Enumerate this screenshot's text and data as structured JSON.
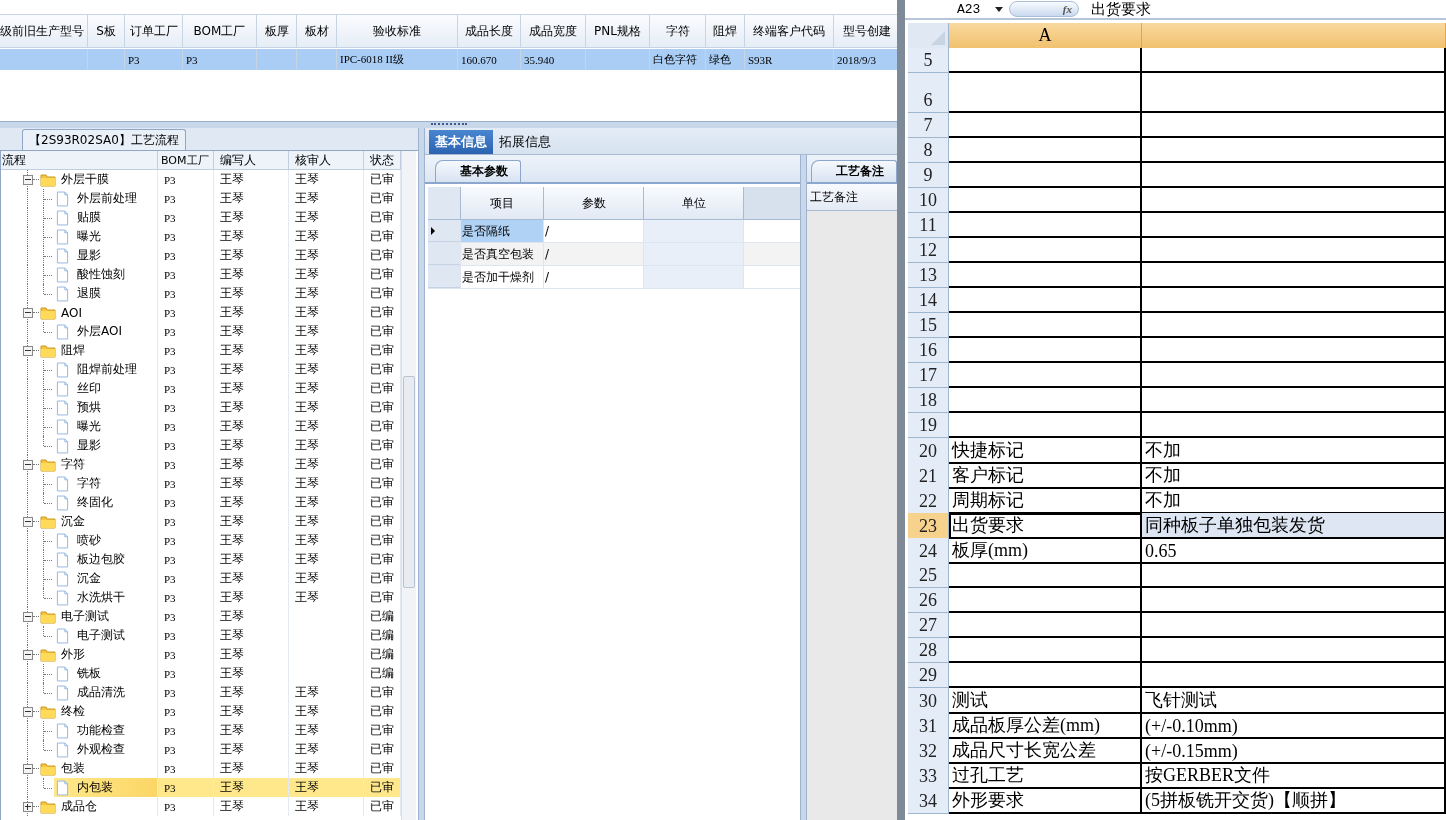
{
  "top_grid": {
    "row_selected": true,
    "columns": [
      {
        "label": "级前旧生产型号"
      },
      {
        "label": "S板"
      },
      {
        "label": "订单工厂",
        "value": "P3"
      },
      {
        "label": "BOM工厂",
        "value": "P3"
      },
      {
        "label": "板厚"
      },
      {
        "label": "板材"
      },
      {
        "label": "验收标准",
        "value": "IPC-6018 II级"
      },
      {
        "label": "成品长度",
        "value": "160.670"
      },
      {
        "label": "成品宽度",
        "value": "35.940"
      },
      {
        "label": "PNL规格"
      },
      {
        "label": "字符",
        "value": "白色字符"
      },
      {
        "label": "阻焊",
        "value": "绿色"
      },
      {
        "label": "终端客户代码",
        "value": "S93R"
      },
      {
        "label": "型号创建",
        "value": "2018/9/3"
      }
    ]
  },
  "process_panel": {
    "title": "【2S93R02SA0】工艺流程",
    "columns": [
      "流程",
      "BOM工厂",
      "编写人",
      "核审人",
      "状态"
    ],
    "tree": [
      {
        "name": "外层干膜",
        "bom": "P3",
        "writer": "王琴",
        "reviewer": "王琴",
        "status": "已审",
        "expanded": true,
        "selected": false,
        "children": [
          {
            "name": "外层前处理",
            "bom": "P3",
            "writer": "王琴",
            "reviewer": "王琴",
            "status": "已审",
            "selected": false
          },
          {
            "name": "贴膜",
            "bom": "P3",
            "writer": "王琴",
            "reviewer": "王琴",
            "status": "已审",
            "selected": false
          },
          {
            "name": "曝光",
            "bom": "P3",
            "writer": "王琴",
            "reviewer": "王琴",
            "status": "已审",
            "selected": false
          },
          {
            "name": "显影",
            "bom": "P3",
            "writer": "王琴",
            "reviewer": "王琴",
            "status": "已审",
            "selected": false
          },
          {
            "name": "酸性蚀刻",
            "bom": "P3",
            "writer": "王琴",
            "reviewer": "王琴",
            "status": "已审",
            "selected": false
          },
          {
            "name": "退膜",
            "bom": "P3",
            "writer": "王琴",
            "reviewer": "王琴",
            "status": "已审",
            "selected": false
          }
        ]
      },
      {
        "name": "AOI",
        "bom": "P3",
        "writer": "王琴",
        "reviewer": "王琴",
        "status": "已审",
        "expanded": true,
        "selected": false,
        "children": [
          {
            "name": "外层AOI",
            "bom": "P3",
            "writer": "王琴",
            "reviewer": "王琴",
            "status": "已审",
            "selected": false
          }
        ]
      },
      {
        "name": "阻焊",
        "bom": "P3",
        "writer": "王琴",
        "reviewer": "王琴",
        "status": "已审",
        "expanded": true,
        "selected": false,
        "children": [
          {
            "name": "阻焊前处理",
            "bom": "P3",
            "writer": "王琴",
            "reviewer": "王琴",
            "status": "已审",
            "selected": false
          },
          {
            "name": "丝印",
            "bom": "P3",
            "writer": "王琴",
            "reviewer": "王琴",
            "status": "已审",
            "selected": false
          },
          {
            "name": "预烘",
            "bom": "P3",
            "writer": "王琴",
            "reviewer": "王琴",
            "status": "已审",
            "selected": false
          },
          {
            "name": "曝光",
            "bom": "P3",
            "writer": "王琴",
            "reviewer": "王琴",
            "status": "已审",
            "selected": false
          },
          {
            "name": "显影",
            "bom": "P3",
            "writer": "王琴",
            "reviewer": "王琴",
            "status": "已审",
            "selected": false
          }
        ]
      },
      {
        "name": "字符",
        "bom": "P3",
        "writer": "王琴",
        "reviewer": "王琴",
        "status": "已审",
        "expanded": true,
        "selected": false,
        "children": [
          {
            "name": "字符",
            "bom": "P3",
            "writer": "王琴",
            "reviewer": "王琴",
            "status": "已审",
            "selected": false
          },
          {
            "name": "终固化",
            "bom": "P3",
            "writer": "王琴",
            "reviewer": "王琴",
            "status": "已审",
            "selected": false
          }
        ]
      },
      {
        "name": "沉金",
        "bom": "P3",
        "writer": "王琴",
        "reviewer": "王琴",
        "status": "已审",
        "expanded": true,
        "selected": false,
        "children": [
          {
            "name": "喷砂",
            "bom": "P3",
            "writer": "王琴",
            "reviewer": "王琴",
            "status": "已审",
            "selected": false
          },
          {
            "name": "板边包胶",
            "bom": "P3",
            "writer": "王琴",
            "reviewer": "王琴",
            "status": "已审",
            "selected": false
          },
          {
            "name": "沉金",
            "bom": "P3",
            "writer": "王琴",
            "reviewer": "王琴",
            "status": "已审",
            "selected": false
          },
          {
            "name": "水洗烘干",
            "bom": "P3",
            "writer": "王琴",
            "reviewer": "王琴",
            "status": "已审",
            "selected": false
          }
        ]
      },
      {
        "name": "电子测试",
        "bom": "P3",
        "writer": "王琴",
        "status": "已编",
        "expanded": true,
        "selected": false,
        "children": [
          {
            "name": "电子测试",
            "bom": "P3",
            "writer": "王琴",
            "status": "已编",
            "selected": false
          }
        ]
      },
      {
        "name": "外形",
        "bom": "P3",
        "writer": "王琴",
        "status": "已编",
        "expanded": true,
        "selected": false,
        "children": [
          {
            "name": "铣板",
            "bom": "P3",
            "writer": "王琴",
            "status": "已编",
            "selected": false
          },
          {
            "name": "成品清洗",
            "bom": "P3",
            "writer": "王琴",
            "reviewer": "王琴",
            "status": "已审",
            "selected": false
          }
        ]
      },
      {
        "name": "终检",
        "bom": "P3",
        "writer": "王琴",
        "reviewer": "王琴",
        "status": "已审",
        "expanded": true,
        "selected": false,
        "children": [
          {
            "name": "功能检查",
            "bom": "P3",
            "writer": "王琴",
            "reviewer": "王琴",
            "status": "已审",
            "selected": false
          },
          {
            "name": "外观检查",
            "bom": "P3",
            "writer": "王琴",
            "reviewer": "王琴",
            "status": "已审",
            "selected": false
          }
        ]
      },
      {
        "name": "包装",
        "bom": "P3",
        "writer": "王琴",
        "reviewer": "王琴",
        "status": "已审",
        "expanded": true,
        "selected": false,
        "children": [
          {
            "name": "内包装",
            "bom": "P3",
            "writer": "王琴",
            "reviewer": "王琴",
            "status": "已审",
            "selected": true
          }
        ]
      },
      {
        "name": "成品仓",
        "bom": "P3",
        "writer": "王琴",
        "reviewer": "王琴",
        "status": "已审",
        "expanded": false,
        "selected": false
      }
    ]
  },
  "detail_tabs": [
    {
      "label": "基本信息",
      "selected": true
    },
    {
      "label": "拓展信息",
      "selected": false
    }
  ],
  "param_panel": {
    "tab": "基本参数",
    "columns": [
      "项目",
      "参数",
      "单位"
    ],
    "rows": [
      {
        "item": "是否隔纸",
        "value": "/",
        "current": true
      },
      {
        "item": "是否真空包装",
        "value": "/",
        "current": false
      },
      {
        "item": "是否加干燥剂",
        "value": "/",
        "current": false
      }
    ]
  },
  "notes_panel": {
    "tab": "工艺备注",
    "column": "工艺备注"
  },
  "spreadsheet": {
    "name_box": "A23",
    "fx_label": "fx",
    "formula": "出货要求",
    "columns": [
      "A"
    ],
    "rows": [
      {
        "number": "5",
        "tall": false,
        "selected": false
      },
      {
        "number": "6",
        "tall": true,
        "selected": false
      },
      {
        "number": "7",
        "tall": false,
        "selected": false
      },
      {
        "number": "8",
        "tall": false,
        "selected": false
      },
      {
        "number": "9",
        "tall": false,
        "selected": false
      },
      {
        "number": "10",
        "tall": false,
        "selected": false
      },
      {
        "number": "11",
        "tall": false,
        "selected": false
      },
      {
        "number": "12",
        "tall": false,
        "selected": false
      },
      {
        "number": "13",
        "tall": false,
        "selected": false
      },
      {
        "number": "14",
        "tall": false,
        "selected": false
      },
      {
        "number": "15",
        "tall": false,
        "selected": false
      },
      {
        "number": "16",
        "tall": false,
        "selected": false
      },
      {
        "number": "17",
        "tall": false,
        "selected": false
      },
      {
        "number": "18",
        "tall": false,
        "selected": false
      },
      {
        "number": "19",
        "tall": false,
        "selected": false
      },
      {
        "number": "20",
        "a": "快捷标记",
        "b": "不加",
        "tall": false,
        "selected": false
      },
      {
        "number": "21",
        "a": "客户标记",
        "b": "不加",
        "tall": false,
        "selected": false
      },
      {
        "number": "22",
        "a": "周期标记",
        "b": "不加",
        "tall": false,
        "selected": false
      },
      {
        "number": "23",
        "a": "出货要求",
        "b": "同种板子单独包装发货",
        "tall": false,
        "selected": true
      },
      {
        "number": "24",
        "a": "板厚(mm)",
        "b": "0.65",
        "tall": false,
        "selected": false
      },
      {
        "number": "25",
        "tall": false,
        "selected": false
      },
      {
        "number": "26",
        "tall": false,
        "selected": false
      },
      {
        "number": "27",
        "tall": false,
        "selected": false
      },
      {
        "number": "28",
        "tall": false,
        "selected": false
      },
      {
        "number": "29",
        "tall": false,
        "selected": false
      },
      {
        "number": "30",
        "a": "测试",
        "b": "飞针测试",
        "tall": false,
        "selected": false
      },
      {
        "number": "31",
        "a": "成品板厚公差(mm)",
        "b": "(+/-0.10mm)",
        "tall": false,
        "selected": false
      },
      {
        "number": "32",
        "a": "成品尺寸长宽公差",
        "b": "(+/-0.15mm)",
        "tall": false,
        "selected": false
      },
      {
        "number": "33",
        "a": "过孔工艺",
        "b": "按GERBER文件",
        "tall": false,
        "selected": false
      },
      {
        "number": "34",
        "a": "外形要求",
        "b": "(5拼板铣开交货)【顺拼】",
        "tall": false,
        "selected": false
      }
    ]
  }
}
